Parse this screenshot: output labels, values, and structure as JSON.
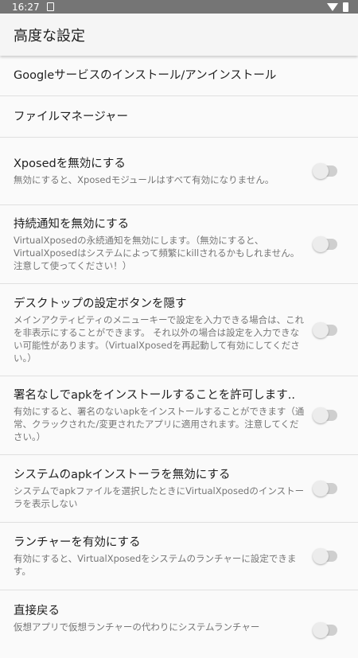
{
  "status_bar": {
    "time": "16:27"
  },
  "app_bar": {
    "title": "高度な設定"
  },
  "settings": [
    {
      "title": "Googleサービスのインストール/アンインストール",
      "summary": "",
      "toggle": false
    },
    {
      "title": "ファイルマネージャー",
      "summary": "",
      "toggle": false
    },
    {
      "title": "Xposedを無効にする",
      "summary": "無効にすると、Xposedモジュールはすべて有効になりません。",
      "toggle": true,
      "checked": false
    },
    {
      "title": "持続通知を無効にする",
      "summary": "VirtualXposedの永続通知を無効にします。（無効にすると、VirtualXposedはシステムによって頻繁にkillされるかもしれません。注意して使ってください！）",
      "toggle": true,
      "checked": false
    },
    {
      "title": "デスクトップの設定ボタンを隠す",
      "summary": "メインアクティビティのメニューキーで設定を入力できる場合は、これを非表示にすることができます。 それ以外の場合は設定を入力できない可能性があります。（VirtualXposedを再起動して有効にしてください。）",
      "toggle": true,
      "checked": false
    },
    {
      "title": "署名なしでapkをインストールすることを許可します..",
      "summary": "有効にすると、署名のないapkをインストールすることができます（通常、クラックされた/変更されたアプリに適用されます。注意してください。）",
      "toggle": true,
      "checked": false
    },
    {
      "title": "システムのapkインストーラを無効にする",
      "summary": "システムでapkファイルを選択したときにVirtualXposedのインストーラを表示しない",
      "toggle": true,
      "checked": false
    },
    {
      "title": "ランチャーを有効にする",
      "summary": "有効にすると、VirtualXposedをシステムのランチャーに設定できます。",
      "toggle": true,
      "checked": false
    },
    {
      "title": "直接戻る",
      "summary": "仮想アプリで仮想ランチャーの代わりにシステムランチャー",
      "toggle": true,
      "checked": false
    }
  ]
}
